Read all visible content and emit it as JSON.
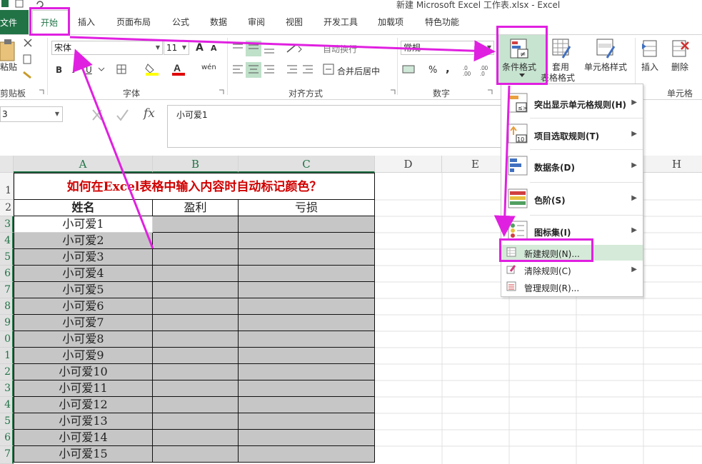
{
  "window": {
    "title": "新建 Microsoft Excel 工作表.xlsx - Excel"
  },
  "tabs": {
    "file": "文件",
    "home": "开始",
    "items": [
      "插入",
      "页面布局",
      "公式",
      "数据",
      "审阅",
      "视图",
      "开发工具",
      "加载项",
      "特色功能"
    ]
  },
  "ribbon": {
    "clipboard": {
      "paste": "粘贴",
      "label": "剪贴板"
    },
    "font": {
      "name": "宋体",
      "size": "11",
      "label": "字体",
      "bold": "B",
      "italic": "I",
      "underline": "U",
      "grow": "A",
      "shrink": "A",
      "phonetic": "wén"
    },
    "alignment": {
      "wrap": "自动换行",
      "merge": "合并后居中",
      "label": "对齐方式"
    },
    "number": {
      "format": "常规",
      "percent": "%",
      "comma": ",",
      "label": "数字"
    },
    "styles": {
      "conditional": "条件格式",
      "table": "套用\n表格格式",
      "table_line1": "套用",
      "table_line2": "表格格式",
      "cell_styles": "单元格样式"
    },
    "cells": {
      "insert": "插入",
      "delete": "删除",
      "label": "单元格"
    }
  },
  "formula_bar": {
    "name_box": "3",
    "content": "小可爱1",
    "fx": "fx"
  },
  "columns": [
    "A",
    "B",
    "C",
    "D",
    "E",
    "F",
    "G",
    "H"
  ],
  "rows": [
    "1",
    "2",
    "3",
    "4",
    "5",
    "6",
    "7",
    "8",
    "9",
    "0",
    "1",
    "2",
    "3",
    "4",
    "5",
    "6",
    "7"
  ],
  "sheet": {
    "title": "如何在Excel表格中输入内容时自动标记颜色？",
    "headers": [
      "姓名",
      "盈利",
      "亏损"
    ],
    "names": [
      "小可爱1",
      "小可爱2",
      "小可爱3",
      "小可爱4",
      "小可爱5",
      "小可爱6",
      "小可爱7",
      "小可爱8",
      "小可爱9",
      "小可爱10",
      "小可爱11",
      "小可爱12",
      "小可爱13",
      "小可爱14",
      "小可爱15"
    ]
  },
  "menu": {
    "highlight_rules": "突出显示单元格规则(H)",
    "top_bottom": "项目选取规则(T)",
    "data_bars": "数据条(D)",
    "color_scales": "色阶(S)",
    "icon_sets": "图标集(I)",
    "new_rule": "新建规则(N)...",
    "clear_rules": "清除规则(C)",
    "manage_rules": "管理规则(R)..."
  },
  "colors": {
    "excel_green": "#217346",
    "annotation": "#e020e0",
    "title_red": "#d00000",
    "shade": "#c6c6c6"
  }
}
